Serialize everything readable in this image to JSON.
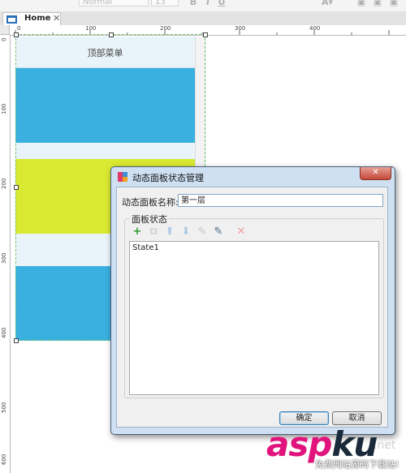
{
  "toolbar": {
    "font_style_value": "Normal",
    "font_size_value": "13",
    "bold_label": "B",
    "italic_label": "I",
    "underline_label": "U"
  },
  "tabs": [
    {
      "label": "Home",
      "close": "✕"
    }
  ],
  "ruler": {
    "horizontal": [
      "0",
      "100",
      "200",
      "300",
      "400"
    ],
    "vertical": [
      "0",
      "100",
      "200",
      "300",
      "400",
      "500",
      "600"
    ]
  },
  "canvas": {
    "top_menu_text": "顶部菜单",
    "colors": {
      "band_light": "#e9f4fa",
      "blue": "#3ab0e0",
      "yellow": "#d9e831"
    }
  },
  "dialog": {
    "title": "动态面板状态管理",
    "close": "✕",
    "panel_name_label": "动态面板名称:",
    "panel_name_value": "第一层",
    "states_group_label": "面板状态",
    "toolbar_icons": [
      "add-icon",
      "duplicate-icon",
      "move-up-icon",
      "move-down-icon",
      "edit-icon",
      "edit-all-icon",
      "delete-icon"
    ],
    "states": [
      "State1"
    ],
    "ok_label": "确定",
    "cancel_label": "取消"
  },
  "watermark": {
    "brand_a": "asp",
    "brand_b": "ku",
    "suffix": ".net",
    "subtitle": "免费网站源码下载站!"
  }
}
